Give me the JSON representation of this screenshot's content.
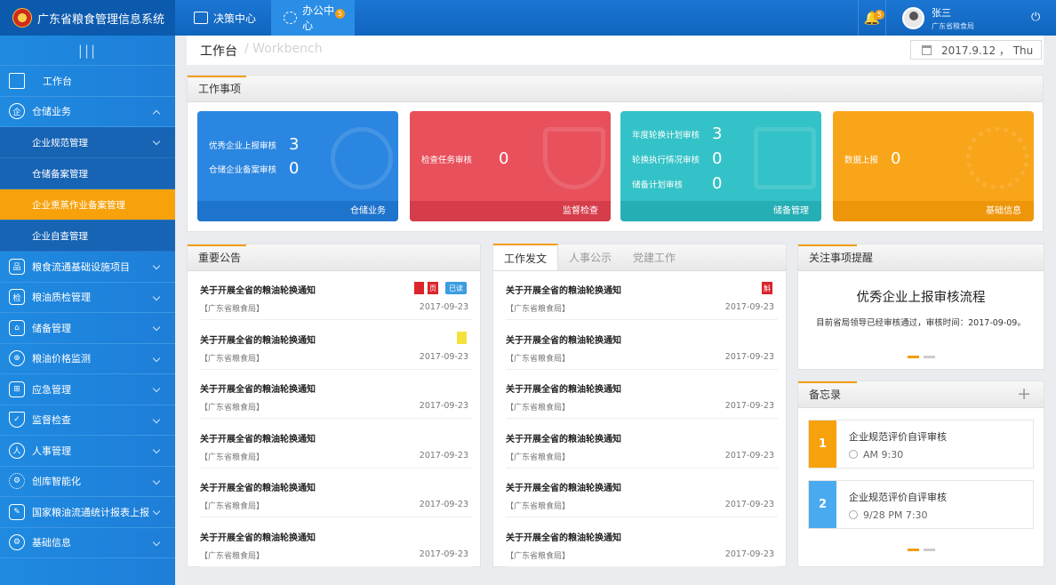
{
  "app": {
    "title": "广东省粮食管理信息系统"
  },
  "topnav": [
    {
      "label": "决策中心"
    },
    {
      "label": "办公中心",
      "badge": "5"
    }
  ],
  "user": {
    "bell_badge": "5",
    "name": "张三",
    "org": "广东省粮食局"
  },
  "sidebar": {
    "collapse_glyph": "|||",
    "items": [
      {
        "label": "工作台",
        "icon": "desk-icon"
      },
      {
        "label": "仓储业务",
        "icon": "warehouse-icon"
      },
      {
        "label": "粮食流通基础设施项目",
        "icon": "network-icon"
      },
      {
        "label": "粮油质检管理",
        "icon": "inspect-icon"
      },
      {
        "label": "储备管理",
        "icon": "reserve-icon"
      },
      {
        "label": "粮油价格监测",
        "icon": "price-icon"
      },
      {
        "label": "应急管理",
        "icon": "emergency-icon"
      },
      {
        "label": "监督检查",
        "icon": "shield-icon"
      },
      {
        "label": "人事管理",
        "icon": "people-icon"
      },
      {
        "label": "创库智能化",
        "icon": "gear-icon"
      },
      {
        "label": "国家粮油流通统计报表上报",
        "icon": "report-icon"
      },
      {
        "label": "基础信息",
        "icon": "settings-icon"
      }
    ],
    "subitems": [
      {
        "label": "企业规范管理"
      },
      {
        "label": "仓储备案管理"
      },
      {
        "label": "企业熏蒸作业备案管理"
      },
      {
        "label": "企业自查管理"
      }
    ]
  },
  "page": {
    "title": "工作台",
    "subtitle": "/ Workbench",
    "date": "2017.9.12 ， Thu"
  },
  "work": {
    "title": "工作事项",
    "cards": [
      {
        "rows": [
          {
            "label": "优秀企业上报审核",
            "value": "3"
          },
          {
            "label": "仓储企业备案审核",
            "value": "0"
          }
        ],
        "footer": "仓储业务",
        "color": "#2a86e0",
        "foot_color": "#1e73cc"
      },
      {
        "rows": [
          {
            "label": "检查任务审核",
            "value": "0"
          }
        ],
        "footer": "监督检查",
        "color": "#e8505c",
        "foot_color": "#d63d4a"
      },
      {
        "rows": [
          {
            "label": "年度轮换计划审核",
            "value": "3"
          },
          {
            "label": "轮换执行情况审核",
            "value": "0"
          },
          {
            "label": "储备计划审核",
            "value": "0"
          }
        ],
        "footer": "储备管理",
        "color": "#33c2c7",
        "foot_color": "#25aeb4"
      },
      {
        "rows": [
          {
            "label": "数据上报",
            "value": "0"
          }
        ],
        "footer": "基础信息",
        "color": "#f9a51a",
        "foot_color": "#ee960a"
      }
    ]
  },
  "notices": {
    "title": "重要公告",
    "items": [
      {
        "title": "关于开展全省的粮油轮换通知",
        "source": "【广东省粮食局】",
        "date": "2017-09-23"
      },
      {
        "title": "关于开展全省的粮油轮换通知",
        "source": "【广东省粮食局】",
        "date": "2017-09-23"
      },
      {
        "title": "关于开展全省的粮油轮换通知",
        "source": "【广东省粮食局】",
        "date": "2017-09-23"
      },
      {
        "title": "关于开展全省的粮油轮换通知",
        "source": "【广东省粮食局】",
        "date": "2017-09-23"
      },
      {
        "title": "关于开展全省的粮油轮换通知",
        "source": "【广东省粮食局】",
        "date": "2017-09-23"
      },
      {
        "title": "关于开展全省的粮油轮换通知",
        "source": "【广东省粮食局】",
        "date": "2017-09-23"
      }
    ],
    "tag_red_text": "页",
    "tag_read": "已读"
  },
  "docs": {
    "tabs": [
      {
        "label": "工作发文"
      },
      {
        "label": "人事公示"
      },
      {
        "label": "党建工作"
      }
    ],
    "tag_text": "斛",
    "items": [
      {
        "title": "关于开展全省的粮油轮换通知",
        "source": "【广东省粮食局】",
        "date": "2017-09-23"
      },
      {
        "title": "关于开展全省的粮油轮换通知",
        "source": "【广东省粮食局】",
        "date": "2017-09-23"
      },
      {
        "title": "关于开展全省的粮油轮换通知",
        "source": "【广东省粮食局】",
        "date": "2017-09-23"
      },
      {
        "title": "关于开展全省的粮油轮换通知",
        "source": "【广东省粮食局】",
        "date": "2017-09-23"
      },
      {
        "title": "关于开展全省的粮油轮换通知",
        "source": "【广东省粮食局】",
        "date": "2017-09-23"
      },
      {
        "title": "关于开展全省的粮油轮换通知",
        "source": "【广东省粮食局】",
        "date": "2017-09-23"
      }
    ]
  },
  "attention": {
    "title": "关注事项提醒",
    "heading": "优秀企业上报审核流程",
    "text": "目前省局领导已经审核通过，审核时间：2017-09-09。"
  },
  "memo": {
    "title": "备忘录",
    "add": "+",
    "items": [
      {
        "num": "1",
        "title": "企业规范评价自评审核",
        "time": "AM  9:30",
        "color": "#f7a10b"
      },
      {
        "num": "2",
        "title": "企业规范评价自评审核",
        "time": "9/28 PM  7:30",
        "color": "#4aaaf0"
      }
    ]
  }
}
